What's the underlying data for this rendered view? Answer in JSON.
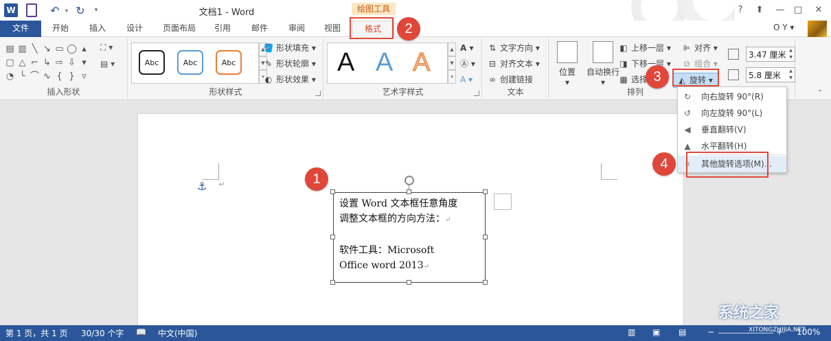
{
  "titlebar": {
    "logo": "W",
    "title": "文档1 - Word",
    "context_tools": "绘图工具",
    "help": "?",
    "minimize": "—",
    "close": "✕"
  },
  "tabs": [
    "文件",
    "开始",
    "插入",
    "设计",
    "页面布局",
    "引用",
    "邮件",
    "审阅",
    "视图",
    "格式"
  ],
  "user": "O Y ▾",
  "ribbon": {
    "insert_shape": {
      "label": "插入形状"
    },
    "shape_style": {
      "label": "形状样式",
      "styles": [
        "Abc",
        "Abc",
        "Abc"
      ],
      "fill": "形状填充",
      "outline": "形状轮廓",
      "effect": "形状效果"
    },
    "wordart": {
      "label": "艺术字样式",
      "samples": [
        "A",
        "A",
        "A"
      ]
    },
    "text": {
      "label": "文本",
      "direction": "文字方向",
      "align": "对齐文本",
      "link": "创建链接"
    },
    "arrange": {
      "label": "排列",
      "position": "位置",
      "wrap": "自动换行",
      "forward": "上移一层",
      "backward": "下移一层",
      "select_pane": "选择",
      "align": "对齐",
      "group": "组合",
      "rotate": "旋转"
    },
    "size": {
      "height": "3.47 厘米",
      "width": "5.8 厘米"
    }
  },
  "document": {
    "textbox_lines": [
      "设置 Word 文本框任意角度",
      "调整文本框的方向方法：",
      "",
      "软件工具：Microsoft",
      "Office word 2013"
    ]
  },
  "rotate_menu": {
    "items": [
      "向右旋转 90°(R)",
      "向左旋转 90°(L)",
      "垂直翻转(V)",
      "水平翻转(H)",
      "其他旋转选项(M)..."
    ]
  },
  "callouts": [
    "1",
    "2",
    "3",
    "4"
  ],
  "statusbar": {
    "page": "第 1 页，共 1 页",
    "words": "30/30 个字",
    "lang": "中文(中国)",
    "zoom": "100%"
  },
  "watermark": {
    "text": "系统之家",
    "url": "XITONGZHIJIA.NET"
  },
  "colors": {
    "accent": "#2b579a",
    "callout": "#e0473a",
    "format_tab": "#d24726"
  }
}
